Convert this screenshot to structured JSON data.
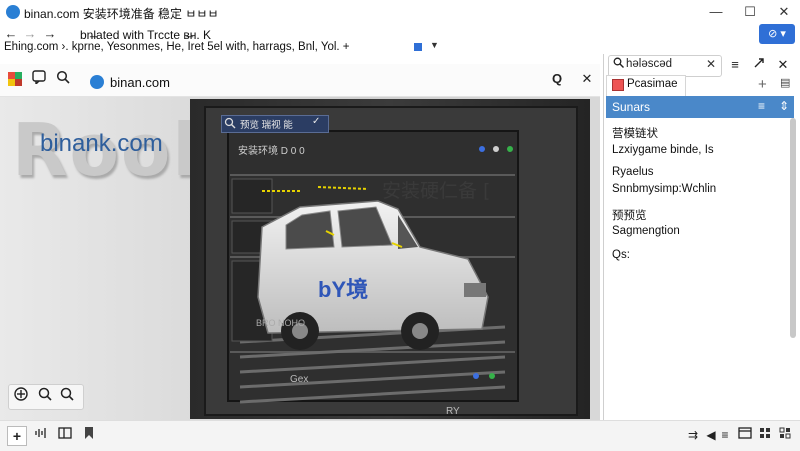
{
  "window": {
    "title": "binan.com 安装环境准备 稳定 ㅂㅂㅂ",
    "minimize": "—",
    "maximize": "☐",
    "close": "✕"
  },
  "nav": {
    "back": "←",
    "forward": "→",
    "forward2": "→",
    "address_text": "bn̶lated with Trccte  ʙ̶ʜ. K",
    "account_button": "⊘ ▾"
  },
  "bookmarks": {
    "text": "Ehing.com  ›. kprne, Yesonmes, He, Iret 5el with, harrags, Bnl, Yol. +"
  },
  "toolbar": {
    "site_name": "binan.com",
    "profile_icon": "Q"
  },
  "viewport": {
    "big_letters": "Rooh",
    "brand": "binank.com",
    "overlay_title": "预览 瑞视 能",
    "overlay_subtitle": "安装环境 D 0 0",
    "env_label": "安装硬仁备 [",
    "van_logo": "bY境",
    "deck_label_1": "BRO NOHO",
    "deck_label_2": "Gex",
    "deck_label_3": "RY"
  },
  "right_panel": {
    "search_text": "hələscəd",
    "tab_label": "Pcasimae",
    "header_label": "Sunars",
    "lines": [
      "营模链状",
      "Lzxiygame binde, Is",
      "Ryaelus",
      "Snnbmysimp:Wchlin",
      "预预览",
      "Sagmengtion",
      "Qs:"
    ]
  }
}
